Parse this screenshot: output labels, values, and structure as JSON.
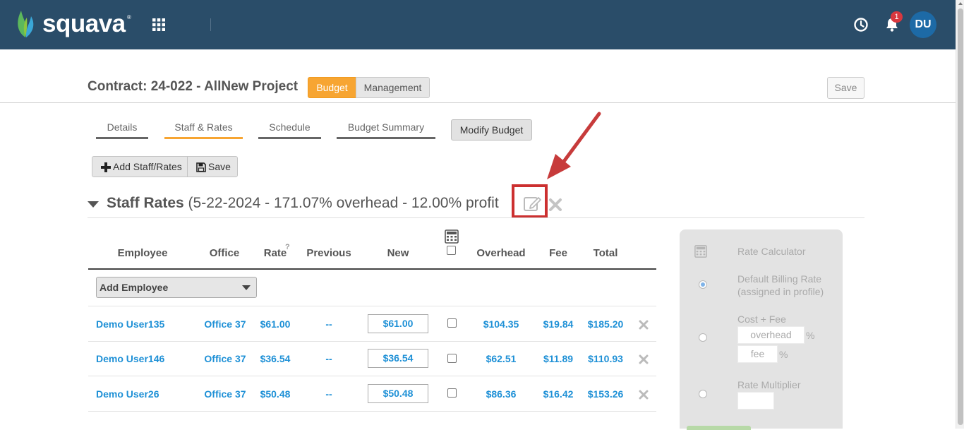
{
  "brand": {
    "name": "squava",
    "reg": "®"
  },
  "header": {
    "notification_count": "1",
    "avatar_initials": "DU"
  },
  "contract": {
    "title": "Contract: 24-022 - AllNew Project",
    "toggle_budget": "Budget",
    "toggle_management": "Management",
    "save_label": "Save"
  },
  "tabs": [
    {
      "label": "Details"
    },
    {
      "label": "Staff & Rates"
    },
    {
      "label": "Schedule"
    },
    {
      "label": "Budget Summary"
    }
  ],
  "modify_budget_label": "Modify Budget",
  "toolbar": {
    "add_staff_label": "Add Staff/Rates",
    "save_label": "Save"
  },
  "section": {
    "title": "Staff Rates",
    "subtitle": "(5-22-2024 - 171.07% overhead - 12.00% profit"
  },
  "table": {
    "headers": {
      "employee": "Employee",
      "office": "Office",
      "rate": "Rate",
      "rate_help": "?",
      "previous": "Previous",
      "new": "New",
      "overhead": "Overhead",
      "fee": "Fee",
      "total": "Total"
    },
    "add_employee_label": "Add Employee",
    "rows": [
      {
        "employee": "Demo User135",
        "office": "Office 37",
        "rate": "$61.00",
        "previous": "--",
        "new": "$61.00",
        "overhead": "$104.35",
        "fee": "$19.84",
        "total": "$185.20"
      },
      {
        "employee": "Demo User146",
        "office": "Office 37",
        "rate": "$36.54",
        "previous": "--",
        "new": "$36.54",
        "overhead": "$62.51",
        "fee": "$11.89",
        "total": "$110.93"
      },
      {
        "employee": "Demo User26",
        "office": "Office 37",
        "rate": "$50.48",
        "previous": "--",
        "new": "$50.48",
        "overhead": "$86.36",
        "fee": "$16.42",
        "total": "$153.26"
      }
    ]
  },
  "calculator": {
    "title": "Rate Calculator",
    "option_default_line1": "Default Billing Rate",
    "option_default_line2": "(assigned in profile)",
    "option_cost_fee": "Cost + Fee",
    "overhead_placeholder": "overhead",
    "fee_placeholder": "fee",
    "percent": "%",
    "option_multiplier": "Rate Multiplier"
  },
  "colors": {
    "header_bg": "#2a4d69",
    "accent_orange": "#f7a532",
    "link_blue": "#1e90d6",
    "highlight_red": "#cc3030"
  }
}
